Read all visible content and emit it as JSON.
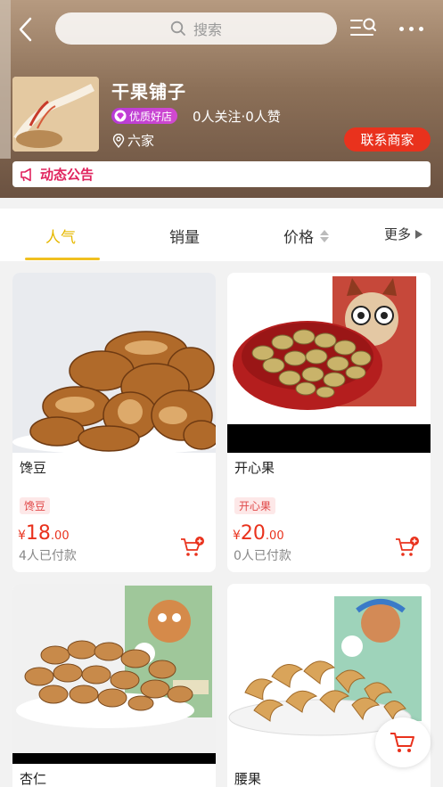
{
  "header": {
    "search_placeholder": "搜索",
    "shop_name": "干果铺子",
    "quality_badge": "优质好店",
    "follow_info": "0人关注·0人赞",
    "location": "六家",
    "contact_label": "联系商家",
    "notice_label": "动态公告"
  },
  "sort_tabs": {
    "popular": "人气",
    "sales": "销量",
    "price": "价格",
    "more": "更多"
  },
  "products": [
    {
      "name": "馋豆",
      "tag": "馋豆",
      "currency": "¥",
      "price_int": "18",
      "price_dec": ".00",
      "sold": "4人已付款"
    },
    {
      "name": "开心果",
      "tag": "开心果",
      "currency": "¥",
      "price_int": "20",
      "price_dec": ".00",
      "sold": "0人已付款"
    },
    {
      "name": "杏仁"
    },
    {
      "name": "腰果"
    }
  ],
  "colors": {
    "accent_red": "#e9321d",
    "tab_active": "#e6b800",
    "notice": "#e0245e"
  }
}
